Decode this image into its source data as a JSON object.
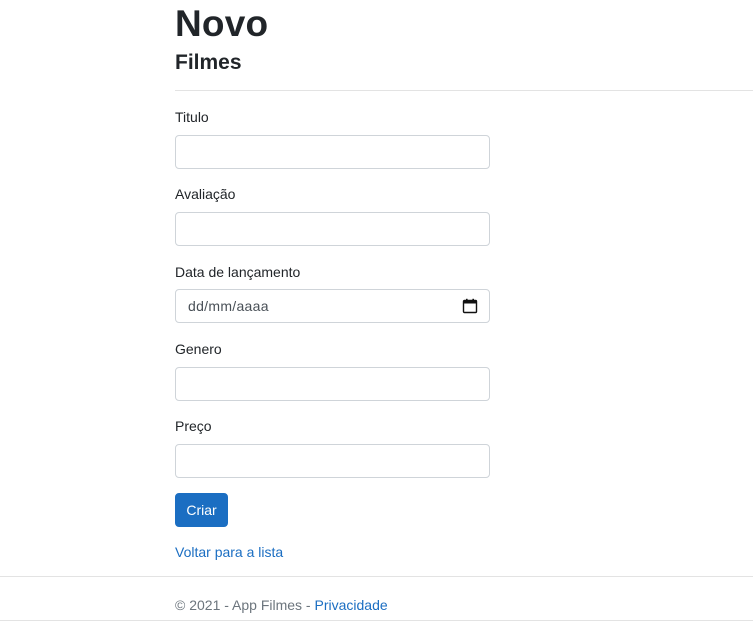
{
  "header": {
    "title": "Novo",
    "subtitle": "Filmes"
  },
  "form": {
    "fields": [
      {
        "label": "Titulo",
        "value": "",
        "type": "text"
      },
      {
        "label": "Avaliação",
        "value": "",
        "type": "text"
      },
      {
        "label": "Data de lançamento",
        "placeholder": "dd/mm/aaaa",
        "type": "date",
        "icon": "calendar-icon"
      },
      {
        "label": "Genero",
        "value": "",
        "type": "text"
      },
      {
        "label": "Preço",
        "value": "",
        "type": "text"
      }
    ],
    "submit_label": "Criar"
  },
  "links": {
    "back_label": "Voltar para a lista"
  },
  "footer": {
    "copyright": "© 2021 - App Filmes -",
    "privacy_label": "Privacidade"
  },
  "colors": {
    "primary": "#1b6ec2",
    "text": "#212529",
    "muted": "#6c757d",
    "border": "#cfd4d9"
  }
}
